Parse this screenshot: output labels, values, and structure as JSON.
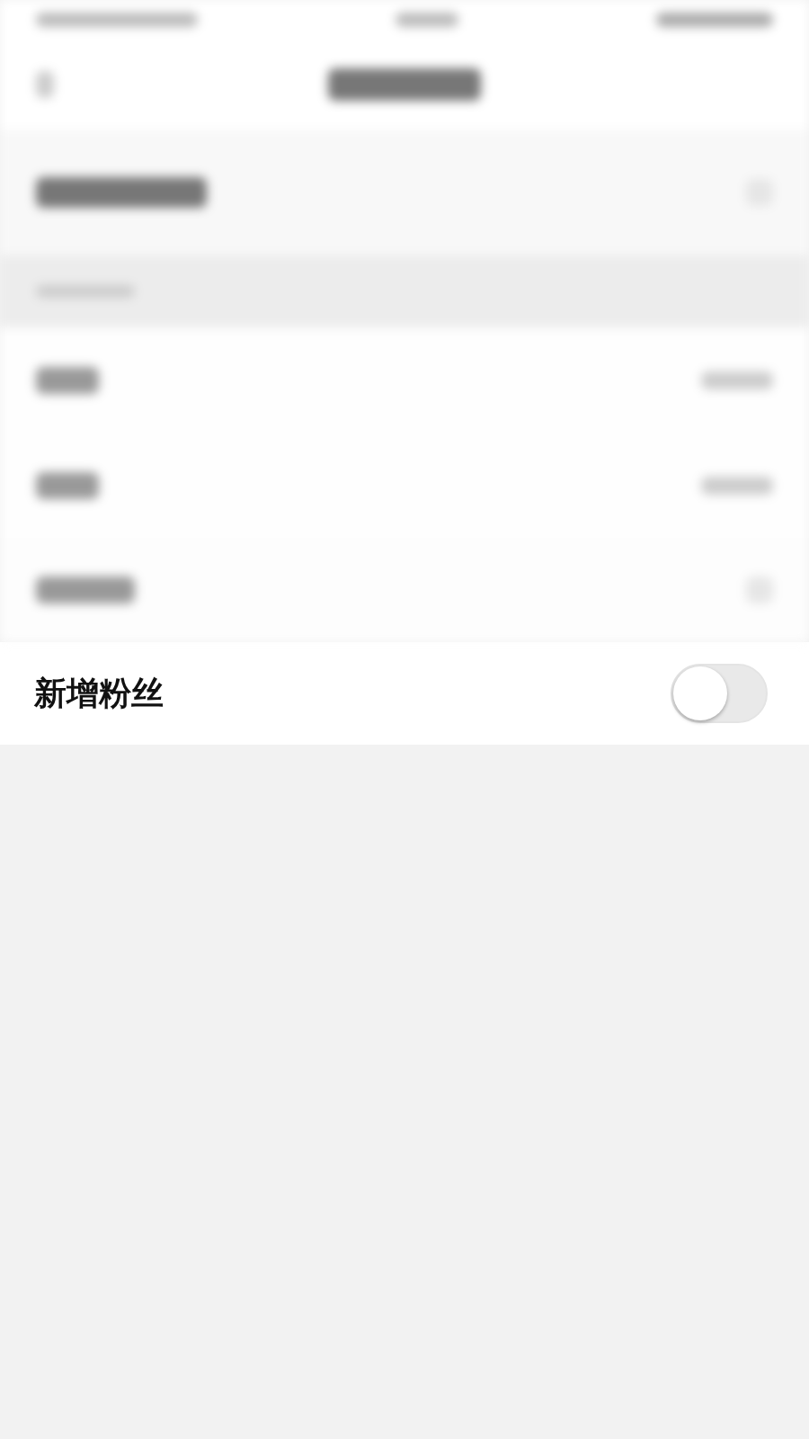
{
  "setting": {
    "label": "新增粉丝",
    "on": false
  }
}
